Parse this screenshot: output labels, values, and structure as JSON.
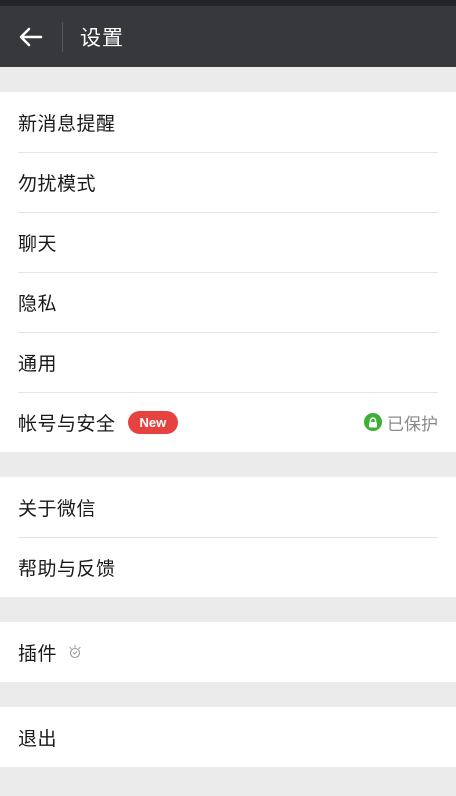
{
  "header": {
    "title": "设置"
  },
  "group1": {
    "items": [
      {
        "label": "新消息提醒"
      },
      {
        "label": "勿扰模式"
      },
      {
        "label": "聊天"
      },
      {
        "label": "隐私"
      },
      {
        "label": "通用"
      },
      {
        "label": "帐号与安全",
        "badge": "New",
        "status": "已保护"
      }
    ]
  },
  "group2": {
    "items": [
      {
        "label": "关于微信"
      },
      {
        "label": "帮助与反馈"
      }
    ]
  },
  "group3": {
    "items": [
      {
        "label": "插件"
      }
    ]
  },
  "group4": {
    "items": [
      {
        "label": "退出"
      }
    ]
  },
  "colors": {
    "header_bg": "#36383b",
    "badge_red": "#e64340",
    "lock_green": "#3cb035",
    "page_bg": "#ebebeb"
  },
  "icons": {
    "back": "arrow-left-icon",
    "lock": "lock-icon",
    "plugin": "plugin-icon"
  }
}
